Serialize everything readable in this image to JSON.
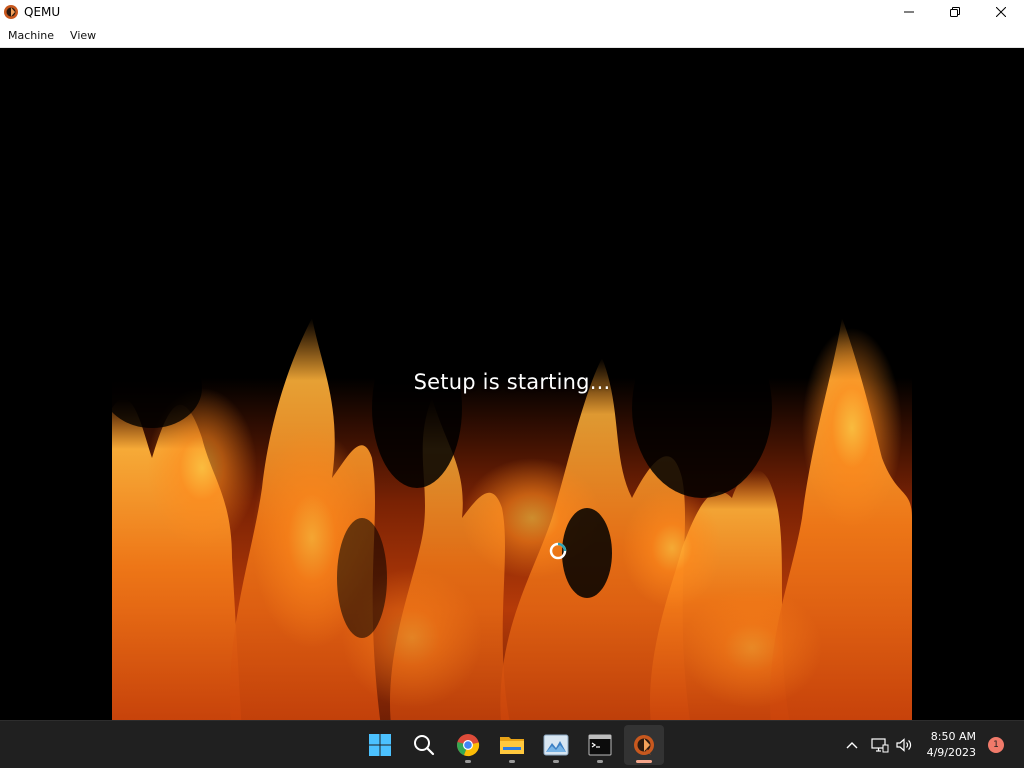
{
  "window": {
    "title": "QEMU",
    "icon": "qemu-logo-icon",
    "controls": [
      "minimize-icon",
      "restore-icon",
      "close-icon"
    ]
  },
  "menubar": {
    "items": [
      {
        "label": "Machine"
      },
      {
        "label": "View"
      }
    ]
  },
  "guest": {
    "background": "fire-flames-image",
    "status_text": "Setup is starting...",
    "spinner": "loading-spinner-icon"
  },
  "taskbar": {
    "apps": [
      {
        "name": "start-icon",
        "running": false
      },
      {
        "name": "search-icon",
        "running": false
      },
      {
        "name": "chrome-icon",
        "running": true
      },
      {
        "name": "file-explorer-icon",
        "running": true
      },
      {
        "name": "photos-icon",
        "running": true
      },
      {
        "name": "terminal-icon",
        "running": true
      },
      {
        "name": "qemu-icon",
        "running": true,
        "active": true
      }
    ],
    "tray": {
      "overflow": "chevron-up-icon",
      "network": "network-icon",
      "volume": "volume-icon",
      "time": "8:50 AM",
      "date": "4/9/2023",
      "notification_count": "1"
    }
  },
  "colors": {
    "titlebar_bg": "#ffffff",
    "taskbar_bg": "#202020",
    "accent_active": "#f4a58a",
    "badge": "#f07a6a"
  }
}
